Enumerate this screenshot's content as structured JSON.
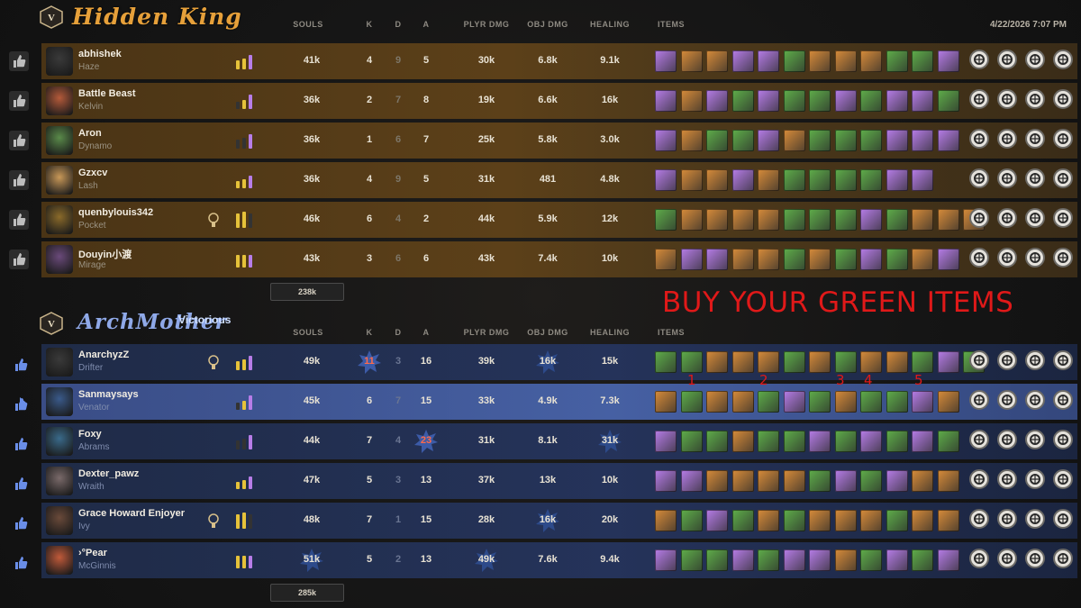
{
  "date": "4/22/2026 7:07 PM",
  "columns": {
    "souls": "SOULS",
    "k": "K",
    "d": "D",
    "a": "A",
    "plyr": "PLYR DMG",
    "obj": "OBJ DMG",
    "heal": "HEALING",
    "items": "ITEMS"
  },
  "caption": "BUY YOUR GREEN ITEMS",
  "markers": [
    "1",
    "2",
    "3",
    "4",
    "5"
  ],
  "colors": {
    "spirit": "#b77de8",
    "weapon": "#d88c3a",
    "vitality": "#5fae4a",
    "souls_stat": "#f0e6c8",
    "caption": "#e01919"
  },
  "teams": [
    {
      "name": "Hidden King",
      "status": "",
      "total_souls": "238k",
      "players": [
        {
          "name": "abhishek",
          "hero": "Haze",
          "souls": "41k",
          "k": "4",
          "d": "9",
          "a": "5",
          "plyr": "30k",
          "obj": "6.8k",
          "heal": "9.1k",
          "items": [
            "spirit",
            "weapon",
            "weapon",
            "spirit",
            "spirit",
            "vitality",
            "weapon",
            "weapon",
            "weapon",
            "vitality",
            "vitality",
            "spirit"
          ],
          "aps": [
            "ap-1",
            "ap-2",
            "ap-3",
            "ap-4"
          ]
        },
        {
          "name": "Battle Beast",
          "hero": "Kelvin",
          "souls": "36k",
          "k": "2",
          "d": "7",
          "a": "8",
          "plyr": "19k",
          "obj": "6.6k",
          "heal": "16k",
          "items": [
            "spirit",
            "weapon",
            "spirit",
            "vitality",
            "spirit",
            "vitality",
            "vitality",
            "spirit",
            "vitality",
            "spirit",
            "spirit",
            "vitality"
          ],
          "aps": [
            "ap-1",
            "ap-2",
            "ap-3",
            "ap-4"
          ]
        },
        {
          "name": "Aron",
          "hero": "Dynamo",
          "souls": "36k",
          "k": "1",
          "d": "6",
          "a": "7",
          "plyr": "25k",
          "obj": "5.8k",
          "heal": "3.0k",
          "items": [
            "spirit",
            "weapon",
            "vitality",
            "vitality",
            "spirit",
            "weapon",
            "vitality",
            "vitality",
            "vitality",
            "spirit",
            "spirit",
            "spirit"
          ],
          "aps": [
            "ap-1",
            "ap-2",
            "ap-3",
            "ap-4"
          ]
        },
        {
          "name": "Gzxcv",
          "hero": "Lash",
          "souls": "36k",
          "k": "4",
          "d": "9",
          "a": "5",
          "plyr": "31k",
          "obj": "481",
          "heal": "4.8k",
          "items": [
            "spirit",
            "weapon",
            "weapon",
            "spirit",
            "weapon",
            "vitality",
            "vitality",
            "vitality",
            "vitality",
            "spirit",
            "spirit"
          ],
          "aps": [
            "ap-1",
            "ap-2",
            "ap-3",
            "ap-4"
          ]
        },
        {
          "name": "quenbylouis342",
          "hero": "Pocket",
          "souls": "46k",
          "k": "6",
          "d": "4",
          "a": "2",
          "plyr": "44k",
          "obj": "5.9k",
          "heal": "12k",
          "items": [
            "vitality",
            "weapon",
            "weapon",
            "weapon",
            "weapon",
            "vitality",
            "vitality",
            "vitality",
            "spirit",
            "vitality",
            "weapon",
            "weapon",
            "weapon"
          ],
          "aps": [
            "ap-1",
            "ap-2",
            "ap-3",
            "ap-4"
          ]
        },
        {
          "name": "Douyin小渡",
          "hero": "Mirage",
          "souls": "43k",
          "k": "3",
          "d": "6",
          "a": "6",
          "plyr": "43k",
          "obj": "7.4k",
          "heal": "10k",
          "items": [
            "weapon",
            "spirit",
            "spirit",
            "weapon",
            "weapon",
            "vitality",
            "weapon",
            "vitality",
            "spirit",
            "vitality",
            "weapon",
            "spirit"
          ],
          "aps": [
            "ap-1",
            "ap-2",
            "ap-3",
            "ap-4"
          ]
        }
      ]
    },
    {
      "name": "ArchMother",
      "status": "Victorious",
      "total_souls": "285k",
      "players": [
        {
          "name": "AnarchyzZ",
          "hero": "Drifter",
          "souls": "49k",
          "k": "11",
          "d": "3",
          "a": "16",
          "plyr": "39k",
          "obj": "16k",
          "heal": "15k",
          "items": [
            "vitality",
            "vitality",
            "weapon",
            "weapon",
            "weapon",
            "vitality",
            "weapon",
            "vitality",
            "weapon",
            "weapon",
            "vitality",
            "spirit",
            "vitality"
          ],
          "aps": [
            "ap-1",
            "ap-2",
            "ap-3",
            "ap-4"
          ]
        },
        {
          "name": "Sanmaysays",
          "hero": "Venator",
          "souls": "45k",
          "k": "6",
          "d": "7",
          "a": "15",
          "plyr": "33k",
          "obj": "4.9k",
          "heal": "7.3k",
          "items": [
            "weapon",
            "vitality",
            "weapon",
            "weapon",
            "vitality",
            "spirit",
            "vitality",
            "weapon",
            "vitality",
            "vitality",
            "spirit",
            "weapon"
          ],
          "aps": [
            "ap-1",
            "ap-2",
            "ap-3",
            "ap-4"
          ]
        },
        {
          "name": "Foxy",
          "hero": "Abrams",
          "souls": "44k",
          "k": "7",
          "d": "4",
          "a": "23",
          "plyr": "31k",
          "obj": "8.1k",
          "heal": "31k",
          "items": [
            "spirit",
            "vitality",
            "vitality",
            "weapon",
            "vitality",
            "vitality",
            "spirit",
            "vitality",
            "spirit",
            "vitality",
            "spirit",
            "vitality"
          ],
          "aps": [
            "ap-1",
            "ap-2",
            "ap-3",
            "ap-4"
          ]
        },
        {
          "name": "Dexter_pawz",
          "hero": "Wraith",
          "souls": "47k",
          "k": "5",
          "d": "3",
          "a": "13",
          "plyr": "37k",
          "obj": "13k",
          "heal": "10k",
          "items": [
            "spirit",
            "spirit",
            "weapon",
            "weapon",
            "weapon",
            "weapon",
            "vitality",
            "spirit",
            "vitality",
            "spirit",
            "weapon",
            "weapon"
          ],
          "aps": [
            "ap-1",
            "ap-2",
            "ap-3",
            "ap-4"
          ]
        },
        {
          "name": "Grace Howard Enjoyer",
          "hero": "Ivy",
          "souls": "48k",
          "k": "7",
          "d": "1",
          "a": "15",
          "plyr": "28k",
          "obj": "16k",
          "heal": "20k",
          "items": [
            "weapon",
            "vitality",
            "spirit",
            "vitality",
            "weapon",
            "vitality",
            "weapon",
            "weapon",
            "weapon",
            "vitality",
            "weapon",
            "weapon"
          ],
          "aps": [
            "ap-1",
            "ap-2",
            "ap-3",
            "ap-4"
          ]
        },
        {
          "name": "›°Pear",
          "hero": "McGinnis",
          "souls": "51k",
          "k": "5",
          "d": "2",
          "a": "13",
          "plyr": "49k",
          "obj": "7.6k",
          "heal": "9.4k",
          "items": [
            "spirit",
            "vitality",
            "vitality",
            "spirit",
            "vitality",
            "spirit",
            "spirit",
            "weapon",
            "vitality",
            "spirit",
            "vitality",
            "spirit"
          ],
          "aps": [
            "ap-1",
            "ap-2",
            "ap-3",
            "ap-4"
          ]
        }
      ]
    }
  ]
}
